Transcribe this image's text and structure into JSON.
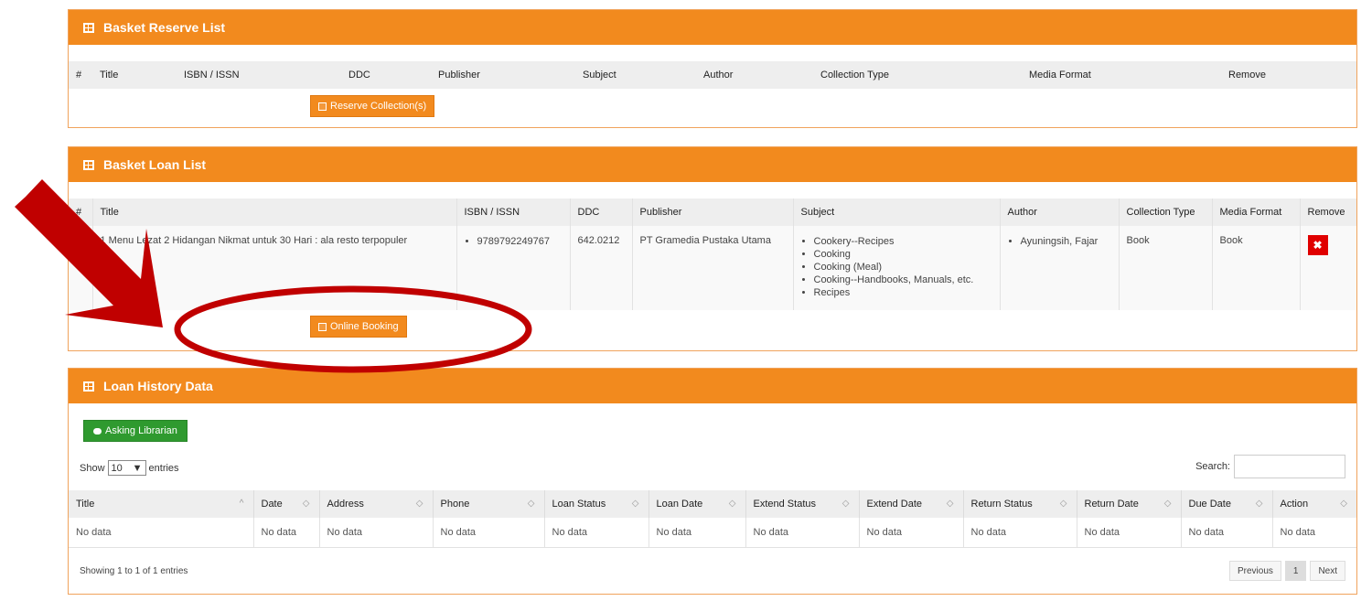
{
  "reserve": {
    "title": "Basket Reserve List",
    "columns": [
      "#",
      "Title",
      "ISBN / ISSN",
      "DDC",
      "Publisher",
      "Subject",
      "Author",
      "Collection Type",
      "Media Format",
      "Remove"
    ],
    "button_label": "Reserve Collection(s)"
  },
  "loan": {
    "title": "Basket Loan List",
    "columns": [
      "#",
      "Title",
      "ISBN / ISSN",
      "DDC",
      "Publisher",
      "Subject",
      "Author",
      "Collection Type",
      "Media Format",
      "Remove"
    ],
    "row": {
      "num": "1.",
      "title": "1 Menu Lezat 2 Hidangan Nikmat untuk 30 Hari : ala resto terpopuler",
      "isbn": "9789792249767",
      "ddc": "642.0212",
      "publisher": "PT Gramedia Pustaka Utama",
      "subjects": [
        "Cookery--Recipes",
        "Cooking",
        "Cooking (Meal)",
        "Cooking--Handbooks, Manuals, etc.",
        "Recipes"
      ],
      "author": "Ayuningsih, Fajar",
      "collection_type": "Book",
      "media_format": "Book",
      "remove_icon": "x-icon"
    },
    "button_label": "Online Booking"
  },
  "history": {
    "title": "Loan History Data",
    "asking_label": "Asking Librarian",
    "show_label": "Show",
    "entries_value": "10",
    "entries_label": "entries",
    "search_label": "Search:",
    "columns": [
      "Title",
      "Date",
      "Address",
      "Phone",
      "Loan Status",
      "Loan Date",
      "Extend Status",
      "Extend Date",
      "Return Status",
      "Return Date",
      "Due Date",
      "Action"
    ],
    "row": [
      "No data",
      "No data",
      "No data",
      "No data",
      "No data",
      "No data",
      "No data",
      "No data",
      "No data",
      "No data",
      "No data",
      "No data"
    ],
    "footer": "Showing 1 to 1 of 1 entries",
    "pager": {
      "previous": "Previous",
      "page": "1",
      "next": "Next"
    }
  },
  "colors": {
    "header_orange": "#f28a1e",
    "annotation_red": "#c00000",
    "remove_red": "#e00000",
    "green": "#2f9a2f"
  }
}
